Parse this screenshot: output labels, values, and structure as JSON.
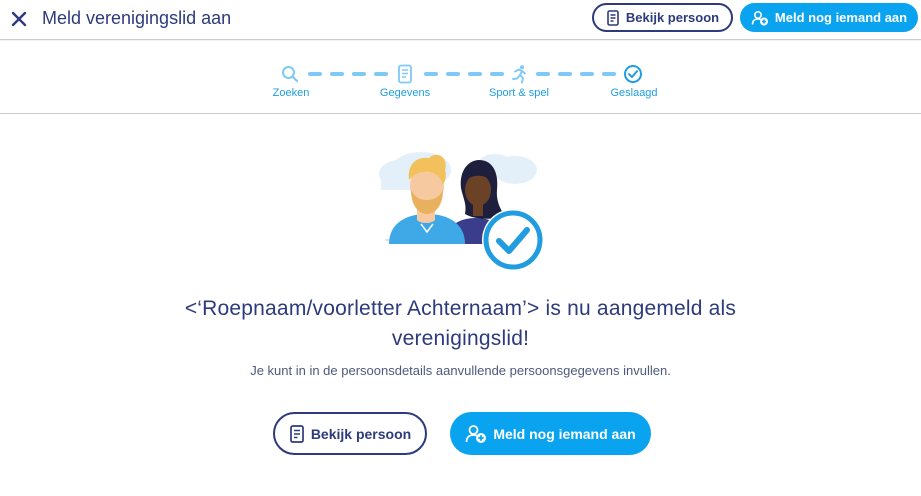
{
  "header": {
    "title": "Meld verenigingslid aan",
    "view_person_label": "Bekijk persoon",
    "add_another_label": "Meld nog iemand aan"
  },
  "stepper": {
    "steps": [
      {
        "label": "Zoeken",
        "icon": "search-icon"
      },
      {
        "label": "Gegevens",
        "icon": "form-icon"
      },
      {
        "label": "Sport & spel",
        "icon": "runner-icon"
      },
      {
        "label": "Geslaagd",
        "icon": "check-circle-icon"
      }
    ],
    "colors": {
      "active": "#1f9de0",
      "dash": "#7fc9f5"
    }
  },
  "main": {
    "headline_line1": "<‘Roepnaam/voorletter Achternaam’> is nu aangemeld als",
    "headline_line2": "verenigingslid!",
    "subline": "Je kunt in in de persoonsdetails aanvullende persoonsgegevens invullen.",
    "view_person_label": "Bekijk persoon",
    "add_another_label": "Meld nog iemand aan"
  },
  "colors": {
    "primary": "#2d3a7c",
    "accent": "#0aa3f0"
  }
}
